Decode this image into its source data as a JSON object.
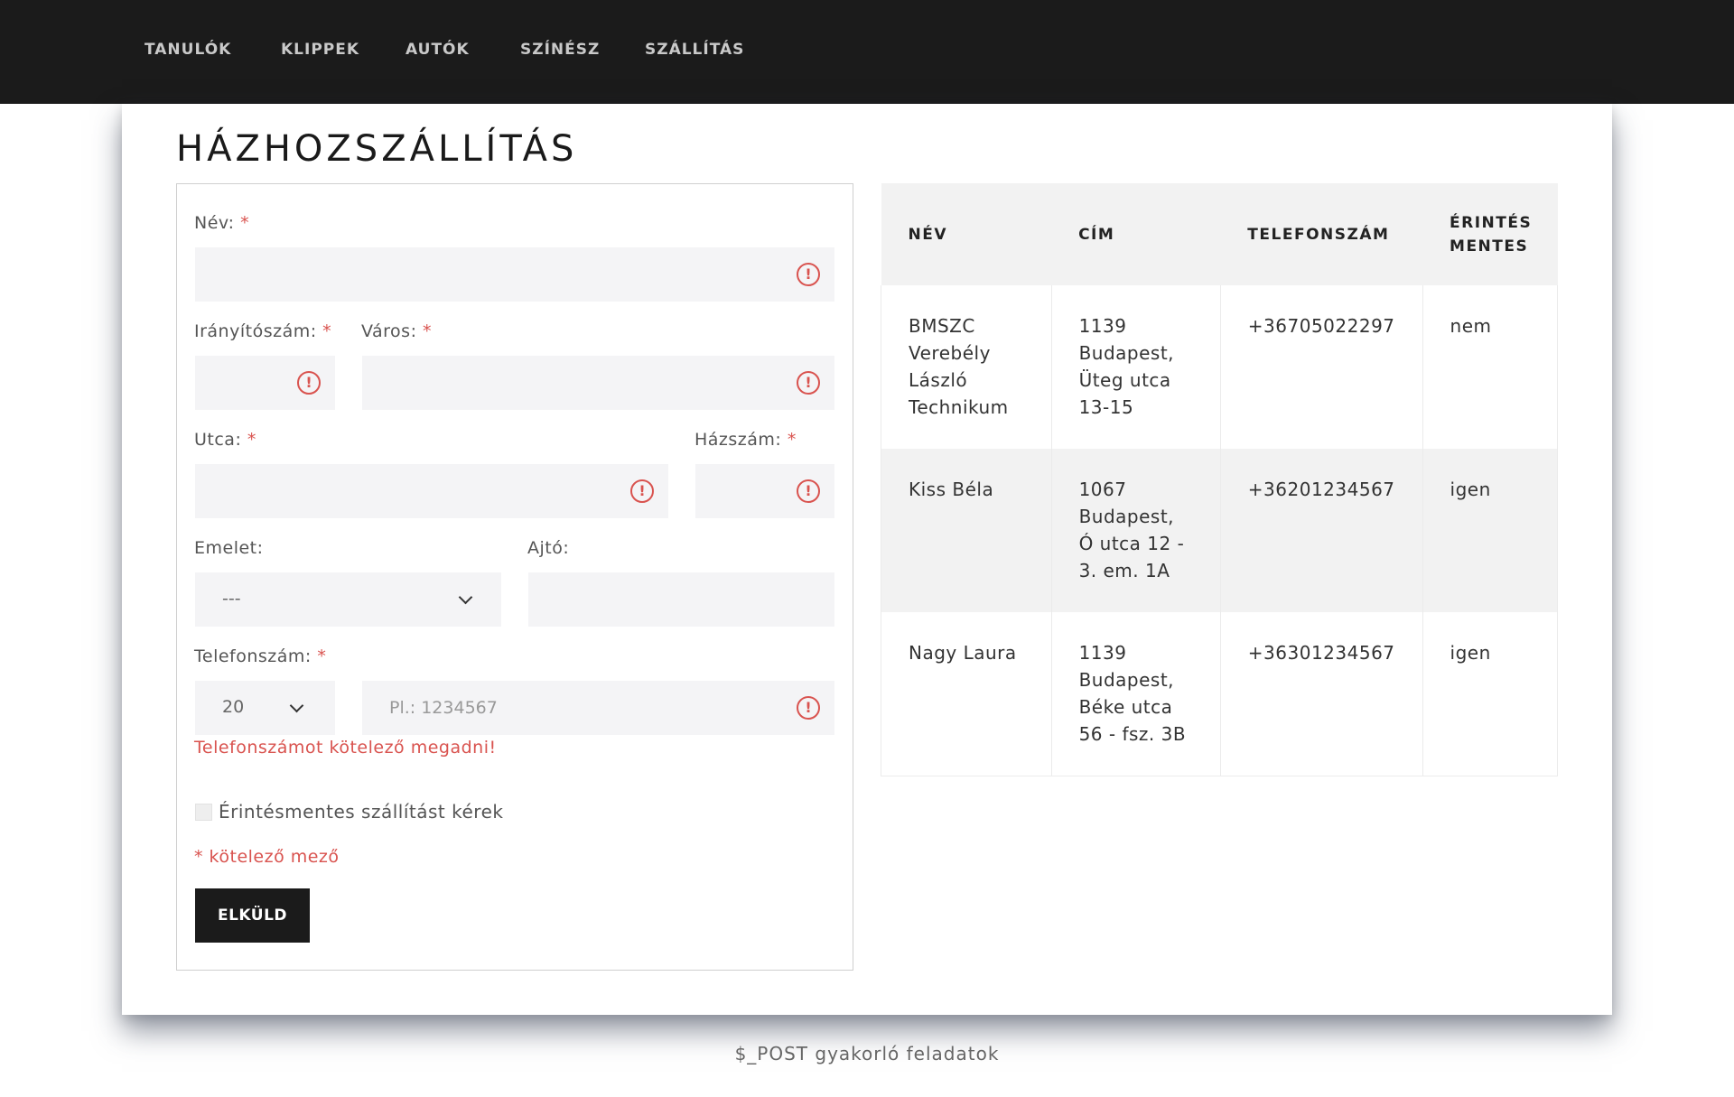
{
  "nav": {
    "items": [
      "TANULÓK",
      "KLIPPEK",
      "AUTÓK",
      "SZÍNÉSZ",
      "SZÁLLÍTÁS"
    ]
  },
  "page": {
    "title": "HÁZHOZSZÁLLÍTÁS"
  },
  "form": {
    "name_label": "Név:",
    "zip_label": "Irányítószám:",
    "city_label": "Város:",
    "street_label": "Utca:",
    "house_label": "Házszám:",
    "floor_label": "Emelet:",
    "floor_value": "---",
    "door_label": "Ajtó:",
    "phone_label": "Telefonszám:",
    "phone_prefix": "20",
    "phone_placeholder": "Pl.: 1234567",
    "required_mark": "*",
    "error_icon": "!",
    "phone_error": "Telefonszámot kötelező megadni!",
    "contactless_label": "Érintésmentes szállítást kérek",
    "required_note": "* kötelező mező",
    "submit_label": "ELKÜLD"
  },
  "table": {
    "headers": [
      "NÉV",
      "CÍM",
      "TELEFONSZÁM",
      "ÉRINTÉS MENTES"
    ],
    "rows": [
      [
        "BMSZC Verebély László Technikum",
        "1139 Budapest, Üteg utca 13-15",
        "+36705022297",
        "nem"
      ],
      [
        "Kiss Béla",
        "1067 Budapest, Ó utca 12 - 3. em. 1A",
        "+36201234567",
        "igen"
      ],
      [
        "Nagy Laura",
        "1139 Budapest, Béke utca 56 - fsz. 3B",
        "+36301234567",
        "igen"
      ]
    ]
  },
  "footer": {
    "text": "$_POST gyakorló feladatok"
  }
}
